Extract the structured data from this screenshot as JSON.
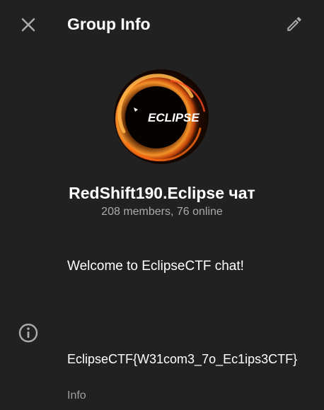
{
  "header": {
    "title": "Group Info",
    "close_icon": "close-icon",
    "edit_icon": "pencil-icon"
  },
  "group": {
    "avatar_text": "ECLIPSE",
    "name": "RedShift190.Eclipse чат",
    "status": "208 members, 76 online",
    "description": "Welcome to EclipseCTF chat!"
  },
  "info": {
    "icon": "info-circle-icon",
    "value": "EclipseCTF{W31com3_7o_Ec1ips3CTF}",
    "label": "Info"
  },
  "colors": {
    "background": "#212121",
    "text_primary": "#ffffff",
    "text_secondary": "#aaaaaa",
    "icon": "#aaaaaa",
    "avatar_glow": "#ff6a1a"
  }
}
